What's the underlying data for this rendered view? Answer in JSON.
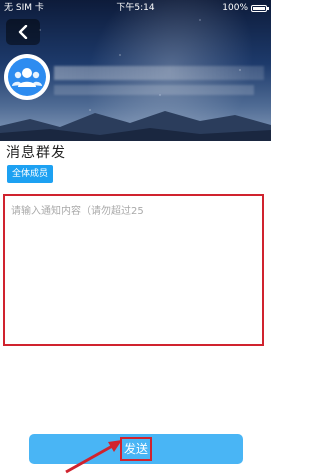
{
  "status_bar": {
    "carrier": "无 SIM 卡",
    "time": "下午5:14",
    "battery": "100%"
  },
  "header": {
    "back_icon": "chevron-left-icon",
    "avatar_icon": "group-icon"
  },
  "page": {
    "title": "消息群发",
    "recipient_tag": "全体成员"
  },
  "message": {
    "placeholder": "请输入通知内容（请勿超过25",
    "value": ""
  },
  "actions": {
    "send_label": "发送"
  },
  "colors": {
    "accent": "#49b5f5",
    "tag": "#1da1f2",
    "highlight": "#d0232e"
  }
}
